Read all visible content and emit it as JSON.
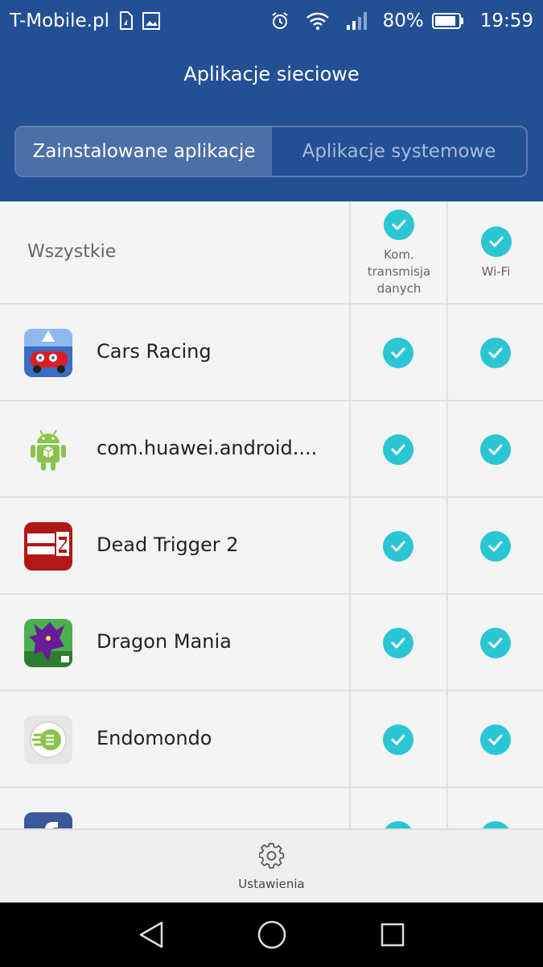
{
  "status_bar": {
    "carrier": "T-Mobile.pl",
    "battery": "80%",
    "time": "19:59"
  },
  "header": {
    "title": "Aplikacje sieciowe"
  },
  "tabs": [
    {
      "label": "Zainstalowane aplikacje",
      "selected": true
    },
    {
      "label": "Aplikacje systemowe",
      "selected": false
    }
  ],
  "list_header": {
    "all_label": "Wszystkie",
    "mobile_data_label_lines": [
      "Kom.",
      "transmisja",
      "danych"
    ],
    "wifi_label": "Wi-Fi",
    "mobile_data_all": true,
    "wifi_all": true
  },
  "apps": [
    {
      "name": "Cars Racing",
      "icon": "cars-racing-icon",
      "mobile_data": true,
      "wifi": true
    },
    {
      "name": "com.huawei.android....",
      "icon": "android-icon",
      "mobile_data": true,
      "wifi": true
    },
    {
      "name": "Dead Trigger 2",
      "icon": "dead-trigger-icon",
      "mobile_data": true,
      "wifi": true
    },
    {
      "name": "Dragon Mania",
      "icon": "dragon-mania-icon",
      "mobile_data": true,
      "wifi": true
    },
    {
      "name": "Endomondo",
      "icon": "endomondo-icon",
      "mobile_data": true,
      "wifi": true
    },
    {
      "name": "",
      "icon": "facebook-icon",
      "mobile_data": true,
      "wifi": true
    }
  ],
  "bottom_bar": {
    "settings_label": "Ustawienia",
    "settings_icon": "gear-icon"
  },
  "nav_bar": {
    "back_icon": "back-icon",
    "home_icon": "home-icon",
    "recents_icon": "recents-icon"
  },
  "colors": {
    "header_blue": "#234f95",
    "check_teal": "#2ac6d4",
    "selected_tab": "#4d6fa8"
  }
}
